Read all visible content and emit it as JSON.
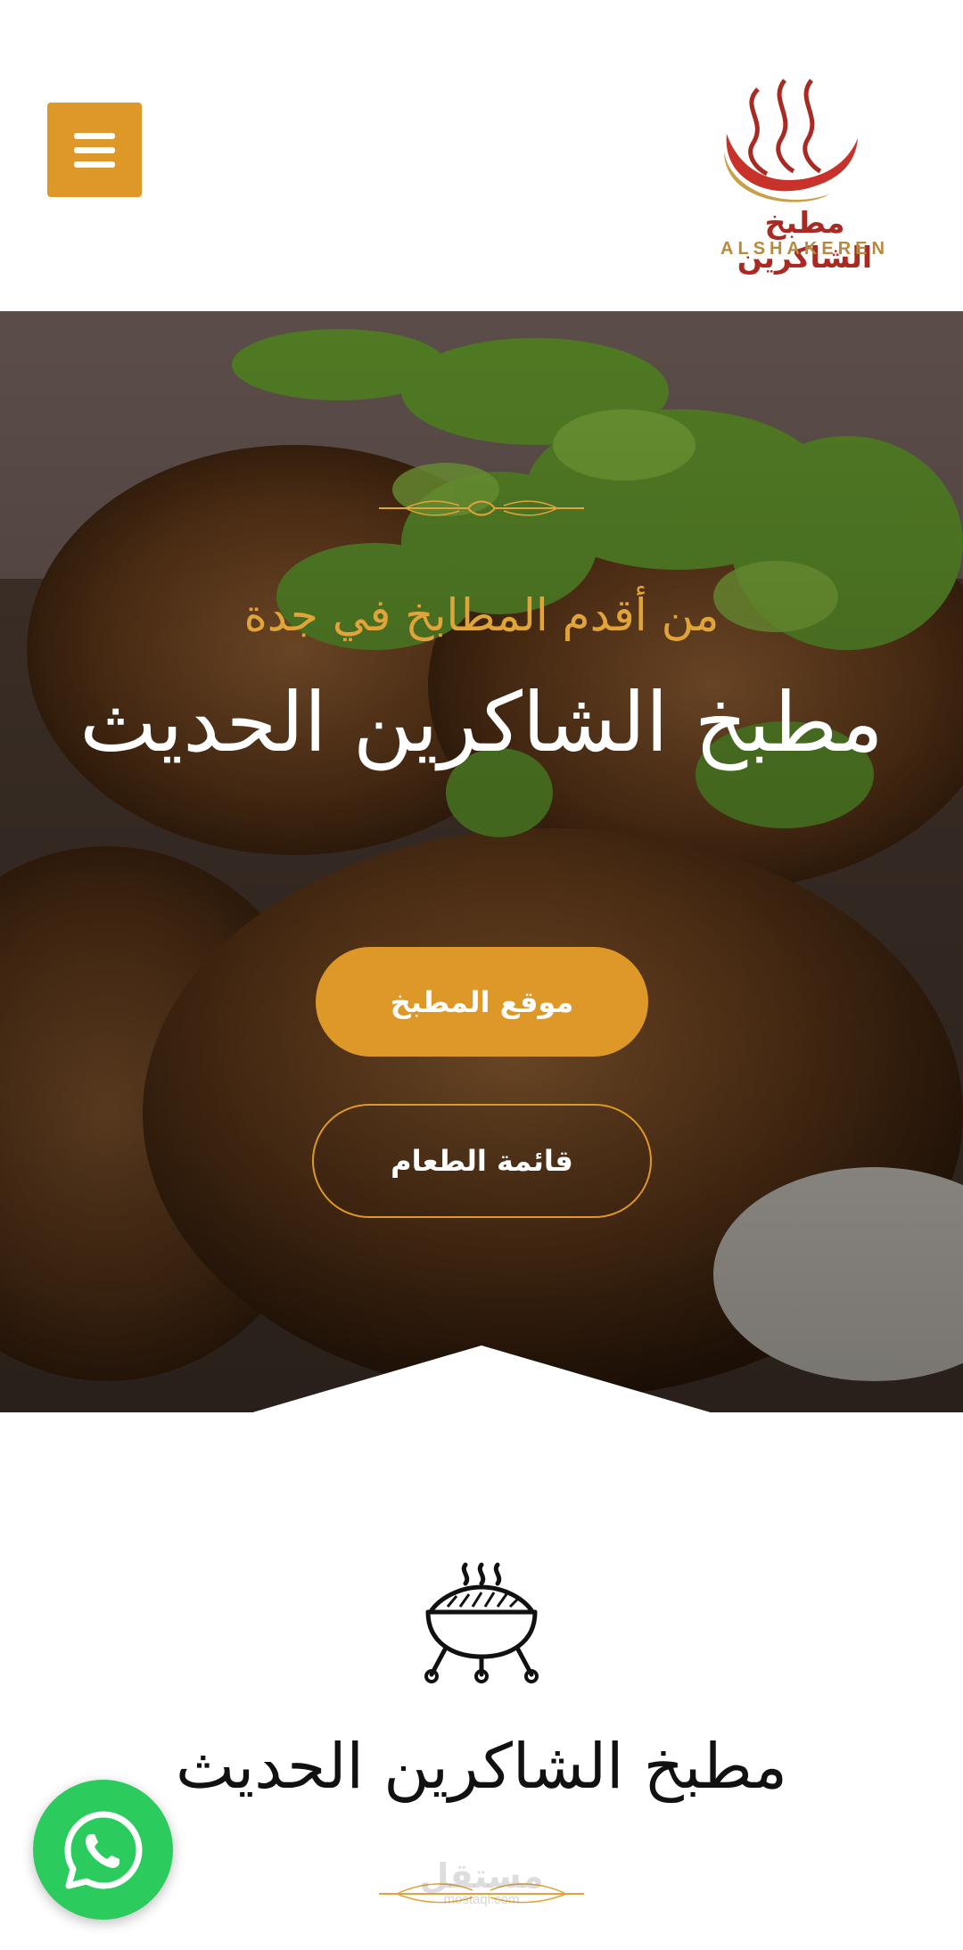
{
  "header": {
    "menu_icon": "hamburger-menu-icon",
    "logo": {
      "arabic_name": "مطبخ الشاكرين",
      "english_name": "ALSHAKEREN",
      "colors": {
        "red": "#a82a22",
        "gold": "#b78a3d"
      }
    }
  },
  "hero": {
    "subtitle": "من أقدم المطابخ في جدة",
    "title": "مطبخ الشاكرين الحديث",
    "primary_button": "موقع المطبخ",
    "secondary_button": "قائمة الطعام"
  },
  "about": {
    "icon": "grill-icon",
    "title": "مطبخ الشاكرين الحديث"
  },
  "watermark": {
    "arabic": "مستقل",
    "english": "mostaql.com"
  },
  "whatsapp": {
    "icon": "whatsapp-icon"
  },
  "colors": {
    "accent": "#de9828",
    "whatsapp": "#2ccb5d"
  }
}
